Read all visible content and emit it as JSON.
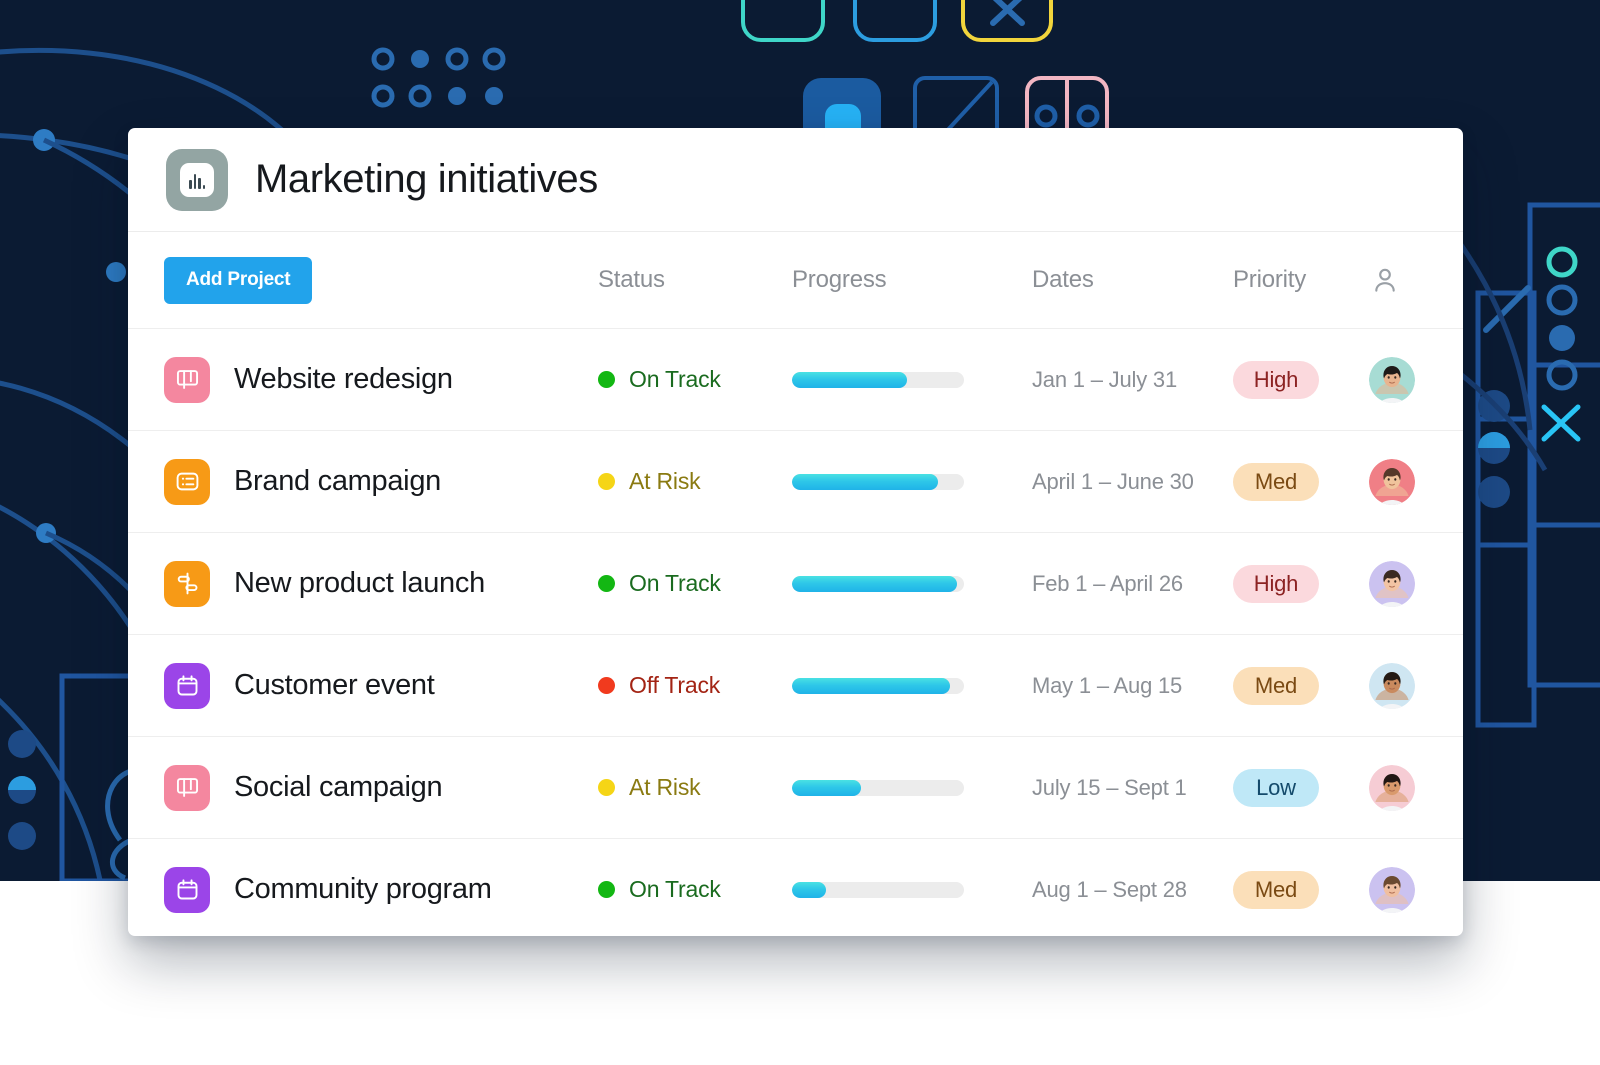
{
  "window": {
    "title": "Marketing initiatives",
    "app_icon": "bar-chart-icon",
    "app_icon_bg": "#93a5a3"
  },
  "background": {
    "color": "#0b1b33",
    "page_color": "#ffffff",
    "decor_accents": [
      "#2f6fb8",
      "#1f4f8f",
      "#3fd6c8",
      "#2c9de0",
      "#f2d53c",
      "#f4a8b8",
      "#29c5f6"
    ]
  },
  "toolbar": {
    "add_project_label": "Add Project",
    "add_project_color": "#22a3eb"
  },
  "table": {
    "columns": [
      {
        "key": "name",
        "label": ""
      },
      {
        "key": "status",
        "label": "Status"
      },
      {
        "key": "progress",
        "label": "Progress"
      },
      {
        "key": "dates",
        "label": "Dates"
      },
      {
        "key": "priority",
        "label": "Priority"
      },
      {
        "key": "owner",
        "label": "",
        "icon": "person-icon"
      }
    ],
    "rows": [
      {
        "icon": "board-icon",
        "icon_bg": "#f4879f",
        "name": "Website redesign",
        "status": "On Track",
        "status_color": "#13b713",
        "status_text_color": "#1a6b1f",
        "progress": 67,
        "dates": "Jan 1 – July 31",
        "priority": "High",
        "priority_bg": "#fbd9dd",
        "priority_fg": "#8c2323",
        "owner_bg": "#a7dcd4",
        "owner_skin": "#e8b48f",
        "owner_hair": "#1e1a18"
      },
      {
        "icon": "list-icon",
        "icon_bg": "#f79a16",
        "name": "Brand campaign",
        "status": "At Risk",
        "status_color": "#f5d516",
        "status_text_color": "#8a7a11",
        "progress": 85,
        "dates": "April 1 – June 30",
        "priority": "Med",
        "priority_bg": "#fbdfb9",
        "priority_fg": "#7a4a13",
        "owner_bg": "#f07f86",
        "owner_skin": "#f0c39c",
        "owner_hair": "#55382a"
      },
      {
        "icon": "timeline-icon",
        "icon_bg": "#f79a16",
        "name": "New product launch",
        "status": "On Track",
        "status_color": "#13b713",
        "status_text_color": "#1a6b1f",
        "progress": 96,
        "dates": "Feb 1 – April 26",
        "priority": "High",
        "priority_bg": "#fbd9dd",
        "priority_fg": "#8c2323",
        "owner_bg": "#cbc2f0",
        "owner_skin": "#f2c4a4",
        "owner_hair": "#3a2a22"
      },
      {
        "icon": "calendar-icon",
        "icon_bg": "#9b45e8",
        "name": "Customer event",
        "status": "Off Track",
        "status_color": "#f13a1e",
        "status_text_color": "#a32414",
        "progress": 92,
        "dates": "May 1 – Aug 15",
        "priority": "Med",
        "priority_bg": "#fbdfb9",
        "priority_fg": "#7a4a13",
        "owner_bg": "#cfe6f2",
        "owner_skin": "#c98a5e",
        "owner_hair": "#241a14"
      },
      {
        "icon": "board-icon",
        "icon_bg": "#f4879f",
        "name": "Social campaign",
        "status": "At Risk",
        "status_color": "#f5d516",
        "status_text_color": "#8a7a11",
        "progress": 40,
        "dates": "July 15 – Sept 1",
        "priority": "Low",
        "priority_bg": "#bfe8f7",
        "priority_fg": "#144a6b",
        "owner_bg": "#f6ccd4",
        "owner_skin": "#d99a6c",
        "owner_hair": "#221713"
      },
      {
        "icon": "calendar-icon",
        "icon_bg": "#9b45e8",
        "name": "Community program",
        "status": "On Track",
        "status_color": "#13b713",
        "status_text_color": "#1a6b1f",
        "progress": 20,
        "dates": "Aug 1 – Sept 28",
        "priority": "Med",
        "priority_bg": "#fbdfb9",
        "priority_fg": "#7a4a13",
        "owner_bg": "#cbc2f0",
        "owner_skin": "#f0bfa0",
        "owner_hair": "#6b4a30"
      }
    ]
  }
}
